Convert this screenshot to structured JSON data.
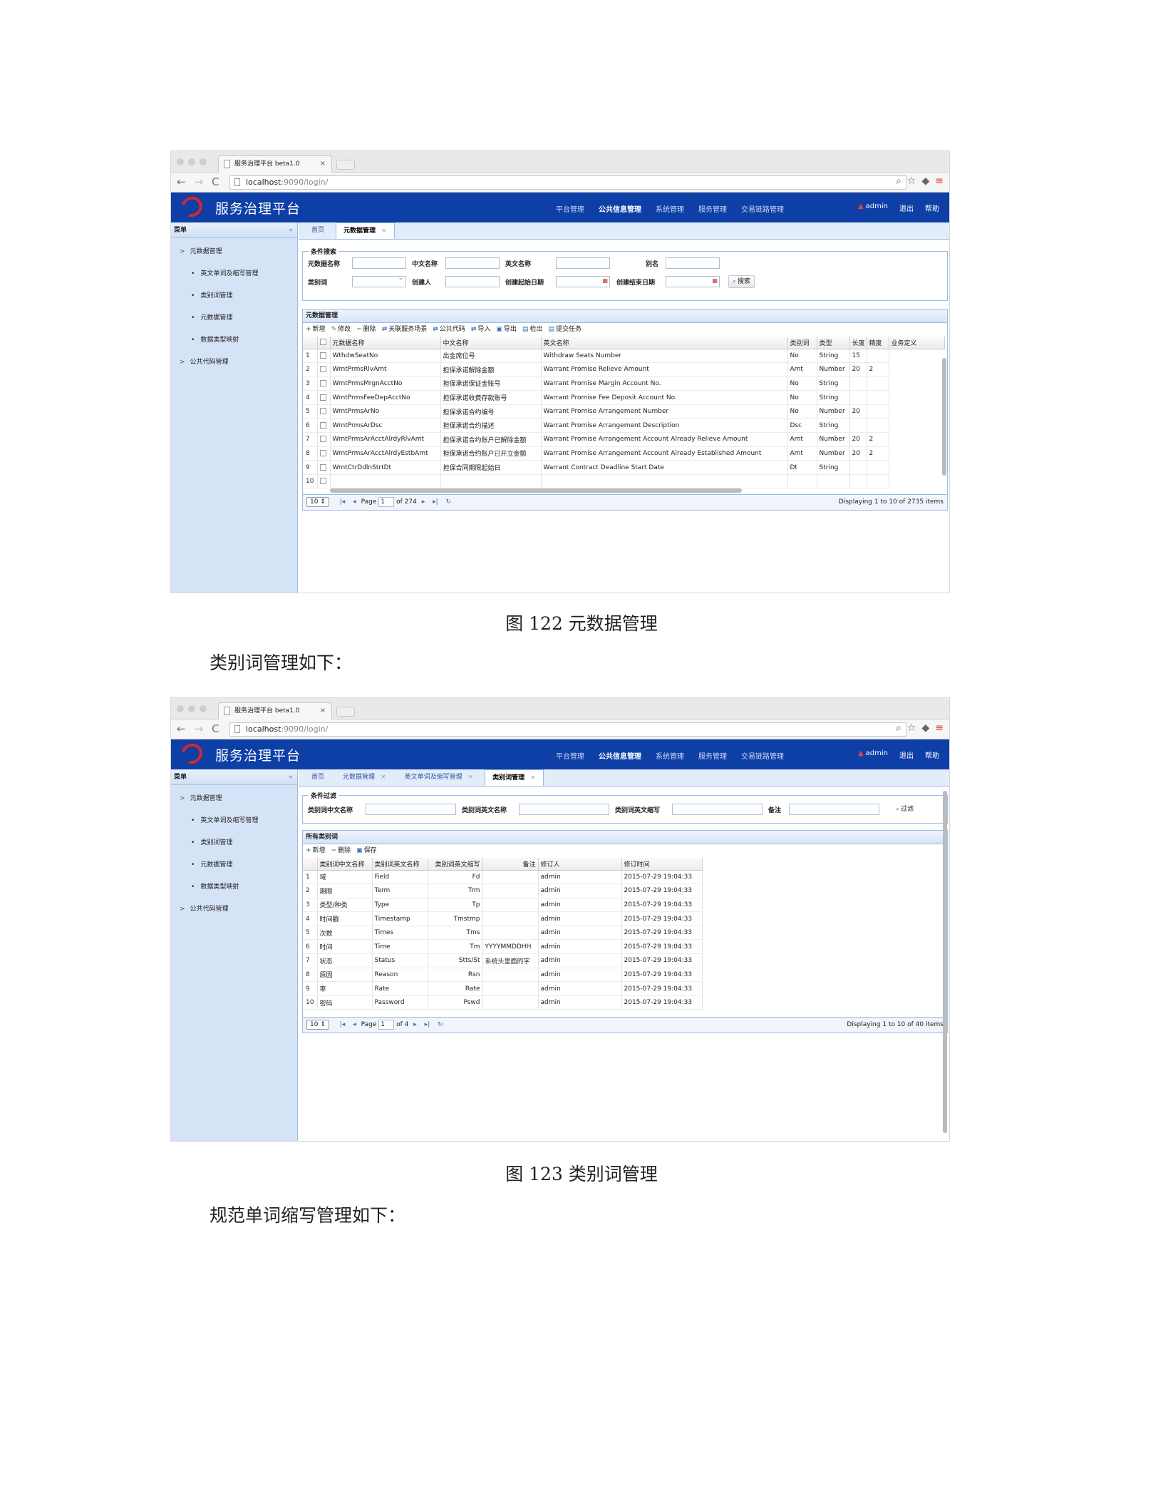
{
  "browser": {
    "tab_title": "服务治理平台 beta1.0",
    "tab_close": "×",
    "url_host": "localhost",
    "url_rest": ":9090/login/"
  },
  "app": {
    "title": "服务治理平台",
    "nav": [
      "平台管理",
      "公共信息管理",
      "系统管理",
      "服务管理",
      "交易链路管理"
    ],
    "active_nav": "公共信息管理",
    "user": "admin",
    "logout": "退出",
    "help": "帮助",
    "brand_colors": {
      "header": "#0d3fa6",
      "sidebar": "#d5e3f7",
      "logo": "#d5272e"
    }
  },
  "sidebar": {
    "title": "菜单",
    "collapse": "«",
    "items": [
      {
        "label": "元数据管理",
        "kind": "top"
      },
      {
        "label": "英文单词及缩写管理",
        "kind": "sub"
      },
      {
        "label": "类别词管理",
        "kind": "sub"
      },
      {
        "label": "元数据管理",
        "kind": "sub"
      },
      {
        "label": "数据类型映射",
        "kind": "sub"
      },
      {
        "label": "公共代码管理",
        "kind": "top"
      }
    ]
  },
  "fig1": {
    "tabs": [
      {
        "label": "首页",
        "closable": false
      },
      {
        "label": "元数据管理",
        "closable": true,
        "active": true
      }
    ],
    "search": {
      "legend": "条件搜索",
      "labels": [
        "元数据名称",
        "中文名称",
        "英文名称",
        "别名",
        "类别词",
        "创建人",
        "创建起始日期",
        "创建结束日期"
      ],
      "button": "搜索"
    },
    "grid": {
      "title": "元数据管理",
      "toolbar": [
        {
          "icon": "plus-icon",
          "glyph": "+",
          "label": "新增"
        },
        {
          "icon": "pencil-icon",
          "glyph": "✎",
          "label": "修改"
        },
        {
          "icon": "minus-icon",
          "glyph": "−",
          "label": "删除"
        },
        {
          "icon": "link-icon",
          "glyph": "⇄",
          "label": "关联服务场景"
        },
        {
          "icon": "code-icon",
          "glyph": "⇄",
          "label": "公共代码"
        },
        {
          "icon": "import-icon",
          "glyph": "⇄",
          "label": "导入"
        },
        {
          "icon": "save-icon",
          "glyph": "▣",
          "label": "导出"
        },
        {
          "icon": "checkout-icon",
          "glyph": "▤",
          "label": "检出"
        },
        {
          "icon": "submit-icon",
          "glyph": "▤",
          "label": "提交任务"
        }
      ],
      "columns": [
        "",
        "",
        "元数据名称",
        "中文名称",
        "英文名称",
        "类别词",
        "类型",
        "长度",
        "精度",
        "业务定义"
      ],
      "rows": [
        [
          "1",
          "WthdwSeatNo",
          "出金席位号",
          "Withdraw Seats Number",
          "No",
          "String",
          "15",
          ""
        ],
        [
          "2",
          "WrntPrmsRlvAmt",
          "担保承诺解除金额",
          "Warrant Promise Relieve Amount",
          "Amt",
          "Number",
          "20",
          "2"
        ],
        [
          "3",
          "WrntPrmsMrgnAcctNo",
          "担保承诺保证金账号",
          "Warrant Promise Margin Account No.",
          "No",
          "String",
          "",
          ""
        ],
        [
          "4",
          "WrntPrmsFeeDepAcctNo",
          "担保承诺收费存款账号",
          "Warrant Promise Fee Deposit Account No.",
          "No",
          "String",
          "",
          ""
        ],
        [
          "5",
          "WrntPrmsArNo",
          "担保承诺合约编号",
          "Warrant Promise Arrangement Number",
          "No",
          "Number",
          "20",
          ""
        ],
        [
          "6",
          "WrntPrmsArDsc",
          "担保承诺合约描述",
          "Warrant Promise Arrangement Description",
          "Dsc",
          "String",
          "",
          ""
        ],
        [
          "7",
          "WrntPrmsArAcctAlrdyRlvAmt",
          "担保承诺合约账户已解除金额",
          "Warrant Promise Arrangement Account Already Relieve Amount",
          "Amt",
          "Number",
          "20",
          "2"
        ],
        [
          "8",
          "WrntPrmsArAcctAlrdyEstbAmt",
          "担保承诺合约账户已开立金额",
          "Warrant Promise Arrangement Account Already Established Amount",
          "Amt",
          "Number",
          "20",
          "2"
        ],
        [
          "9",
          "WrntCtrDdlnStrtDt",
          "担保合同期限起始日",
          "Warrant Contract Deadline Start Date",
          "Dt",
          "String",
          "",
          ""
        ],
        [
          "10",
          "",
          "",
          "",
          "",
          "",
          "",
          ""
        ]
      ]
    },
    "pager": {
      "size": "10",
      "page_label": "Page",
      "page": "1",
      "of": "of 274",
      "display": "Displaying 1 to 10 of 2735 items"
    }
  },
  "fig2": {
    "tabs": [
      {
        "label": "首页",
        "closable": false
      },
      {
        "label": "元数据管理",
        "closable": true
      },
      {
        "label": "英文单词及缩写管理",
        "closable": true
      },
      {
        "label": "类别词管理",
        "closable": true,
        "active": true
      }
    ],
    "filter": {
      "legend": "条件过滤",
      "labels": [
        "类别词中文名称",
        "类别词英文名称",
        "类别词英文缩写",
        "备注"
      ],
      "button": "过滤"
    },
    "grid": {
      "title": "所有类别词",
      "toolbar": [
        {
          "icon": "plus-icon",
          "glyph": "+",
          "label": "新增"
        },
        {
          "icon": "minus-icon",
          "glyph": "−",
          "label": "删除"
        },
        {
          "icon": "save-icon",
          "glyph": "▣",
          "label": "保存"
        }
      ],
      "columns": [
        "",
        "类别词中文名称",
        "类别词英文名称",
        "类别词英文缩写",
        "备注",
        "修订人",
        "修订时间"
      ],
      "rows": [
        [
          "1",
          "域",
          "Field",
          "Fd",
          "",
          "admin",
          "2015-07-29 19:04:33"
        ],
        [
          "2",
          "期限",
          "Term",
          "Trm",
          "",
          "admin",
          "2015-07-29 19:04:33"
        ],
        [
          "3",
          "类型/种类",
          "Type",
          "Tp",
          "",
          "admin",
          "2015-07-29 19:04:33"
        ],
        [
          "4",
          "时间戳",
          "Timestamp",
          "Tmstmp",
          "",
          "admin",
          "2015-07-29 19:04:33"
        ],
        [
          "5",
          "次数",
          "Times",
          "Tms",
          "",
          "admin",
          "2015-07-29 19:04:33"
        ],
        [
          "6",
          "时间",
          "Time",
          "Tm",
          "YYYYMMDDHH",
          "admin",
          "2015-07-29 19:04:33"
        ],
        [
          "7",
          "状态",
          "Status",
          "Stts/St",
          "系统头里面的字",
          "admin",
          "2015-07-29 19:04:33"
        ],
        [
          "8",
          "原因",
          "Reason",
          "Rsn",
          "",
          "admin",
          "2015-07-29 19:04:33"
        ],
        [
          "9",
          "率",
          "Rate",
          "Rate",
          "",
          "admin",
          "2015-07-29 19:04:33"
        ],
        [
          "10",
          "密码",
          "Password",
          "Pswd",
          "",
          "admin",
          "2015-07-29 19:04:33"
        ]
      ]
    },
    "pager": {
      "size": "10",
      "page_label": "Page",
      "page": "1",
      "of": "of 4",
      "display": "Displaying 1 to 10 of 40 items"
    }
  },
  "doc": {
    "caption1": "图 122  元数据管理",
    "para1": "类别词管理如下：",
    "caption2": "图 123  类别词管理",
    "para2": "规范单词缩写管理如下："
  }
}
